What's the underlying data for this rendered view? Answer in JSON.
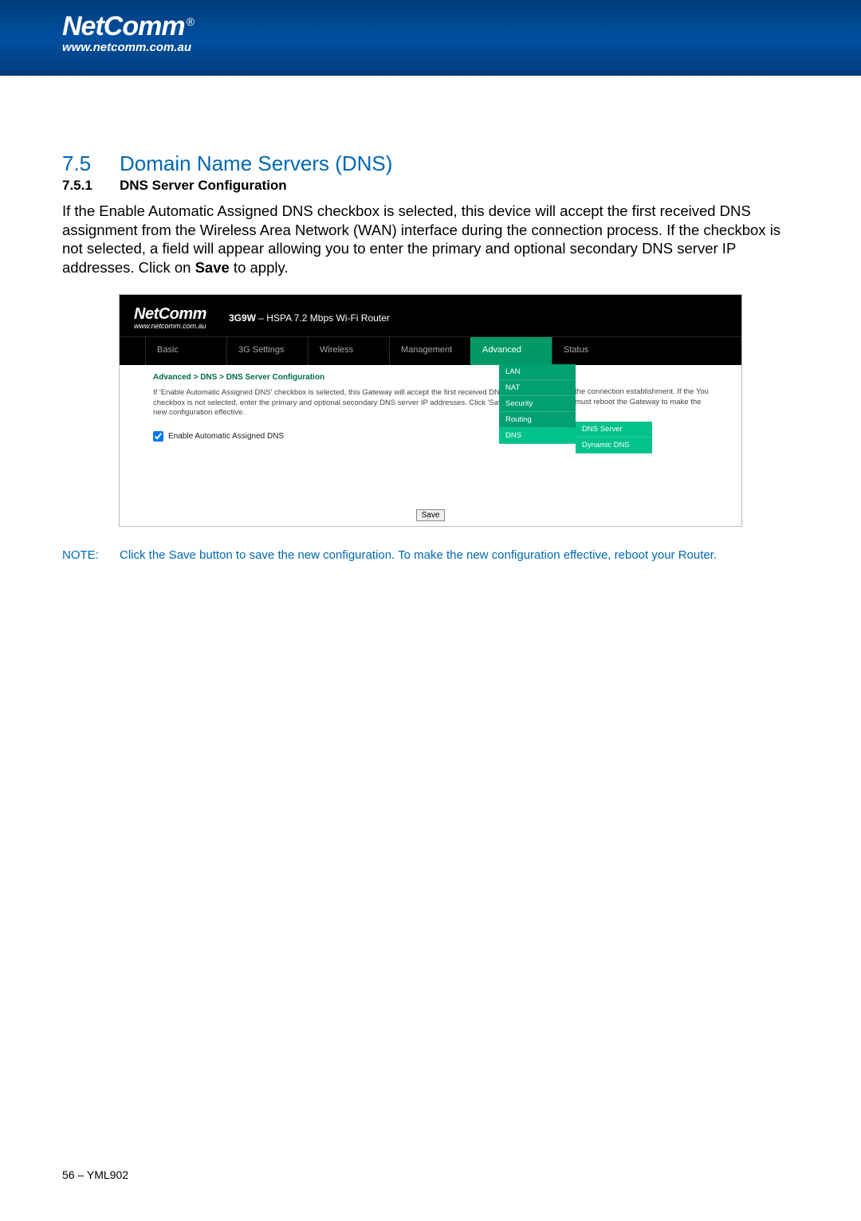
{
  "header": {
    "brand": "NetComm",
    "brand_url": "www.netcomm.com.au",
    "reg": "®"
  },
  "section": {
    "num": "7.5",
    "title": "Domain Name Servers (DNS)",
    "sub_num": "7.5.1",
    "sub_title": "DNS Server Configuration",
    "body": "If the Enable Automatic Assigned DNS checkbox is selected, this device will accept the first received DNS assignment from the Wireless Area Network (WAN) interface during the connection process.  If the checkbox is not selected, a field will appear allowing you to enter the primary and optional secondary DNS server IP addresses. Click on ",
    "body_bold": "Save",
    "body_tail": " to apply."
  },
  "screenshot": {
    "brand": "NetComm",
    "brand_url": "www.netcomm.com.au",
    "product_bold": "3G9W",
    "product_rest": " – HSPA 7.2 Mbps Wi-Fi Router",
    "menu": [
      "Basic",
      "3G Settings",
      "Wireless",
      "Management",
      "Advanced",
      "Status"
    ],
    "breadcrumb": "Advanced > DNS > DNS Server Configuration",
    "desc_left": "If 'Enable Automatic Assigned DNS' checkbox is selected, this Gateway will accept the first received DNS assignment checkbox is not selected, enter the primary and optional secondary DNS server IP addresses. Click 'Save' button to new configuration effective.",
    "desc_right": "the connection establishment. If the You must reboot the Gateway to make the",
    "checkbox_label": "Enable Automatic Assigned DNS",
    "dropdown": [
      "LAN",
      "NAT",
      "Security",
      "Routing",
      "DNS"
    ],
    "flyout": [
      "DNS Server",
      "Dynamic DNS"
    ],
    "save_label": "Save"
  },
  "note": {
    "label": "NOTE:",
    "text": "Click the Save button to save the new configuration.  To make the new configuration effective, reboot your Router."
  },
  "footer": {
    "page": "56 – YML902"
  }
}
